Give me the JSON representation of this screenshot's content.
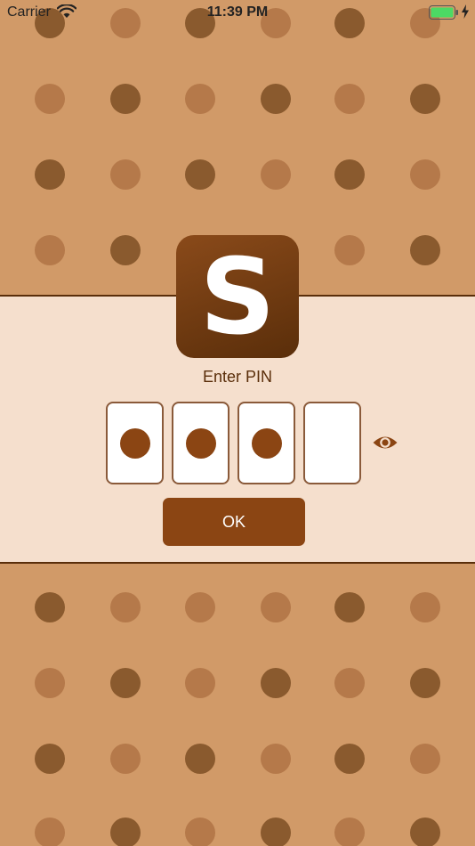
{
  "status_bar": {
    "carrier": "Carrier",
    "time": "11:39 PM"
  },
  "app": {
    "logo_letter": "S"
  },
  "pin": {
    "label": "Enter PIN",
    "digits_entered": 3,
    "digit_count": 4
  },
  "ok_button": {
    "label": "OK"
  },
  "colors": {
    "background": "#d19a68",
    "panel": "#f5dfcd",
    "dot_dark": "#8a5a2e",
    "dot_light": "#b5794a",
    "accent": "#8b4513",
    "battery": "#4cd964"
  }
}
